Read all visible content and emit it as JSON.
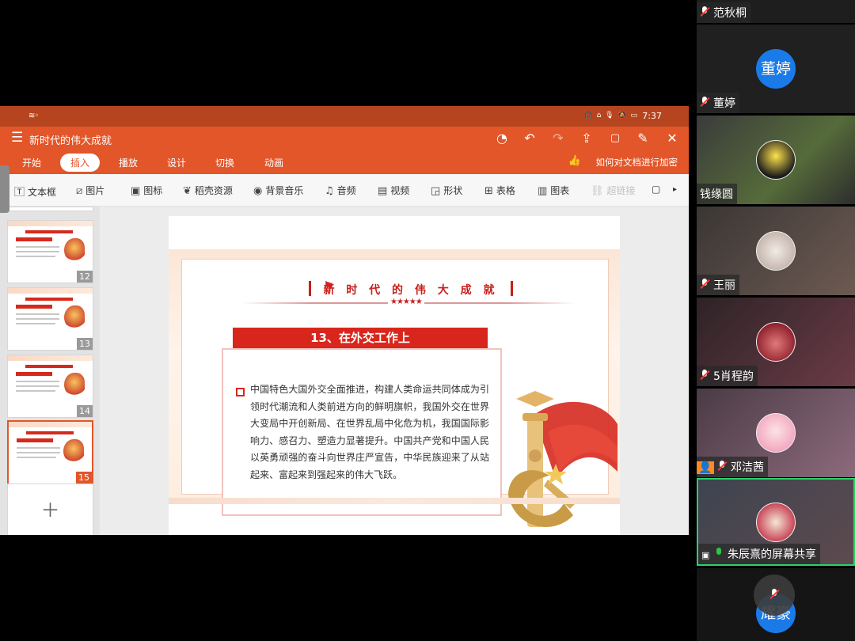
{
  "status_bar": {
    "time": "7:37",
    "battery": "100"
  },
  "document": {
    "title": "新时代的伟大成就"
  },
  "tabs": [
    {
      "label": "开始",
      "active": false
    },
    {
      "label": "插入",
      "active": true
    },
    {
      "label": "播放",
      "active": false
    },
    {
      "label": "设计",
      "active": false
    },
    {
      "label": "切换",
      "active": false
    },
    {
      "label": "动画",
      "active": false
    }
  ],
  "encrypt_link": "如何对文档进行加密",
  "insert_tools": [
    {
      "label": "文本框",
      "icon": "text-box-icon"
    },
    {
      "label": "图片",
      "icon": "image-icon"
    },
    {
      "label": "图标",
      "icon": "icon-library-icon"
    },
    {
      "label": "稻壳资源",
      "icon": "docer-resource-icon"
    },
    {
      "label": "背景音乐",
      "icon": "music-note-icon"
    },
    {
      "label": "音频",
      "icon": "audio-icon"
    },
    {
      "label": "视频",
      "icon": "video-icon"
    },
    {
      "label": "形状",
      "icon": "shape-icon"
    },
    {
      "label": "表格",
      "icon": "table-icon"
    },
    {
      "label": "图表",
      "icon": "chart-icon"
    },
    {
      "label": "超链接",
      "icon": "link-icon",
      "disabled": true
    }
  ],
  "thumbnails": [
    {
      "number": "12",
      "selected": false
    },
    {
      "number": "13",
      "selected": false
    },
    {
      "number": "14",
      "selected": false
    },
    {
      "number": "15",
      "selected": true
    }
  ],
  "slide": {
    "heading": "新 时 代 的 伟 大 成 就",
    "section_title": "13、在外交工作上",
    "body": "中国特色大国外交全面推进，构建人类命运共同体成为引领时代潮流和人类前进方向的鲜明旗帜，我国外交在世界大变局中开创新局、在世界乱局中化危为机，我国国际影响力、感召力、塑造力显著提升。中国共产党和中国人民以英勇顽强的奋斗向世界庄严宣告，中华民族迎来了从站起来、富起来到强起来的伟大飞跃。"
  },
  "participants": [
    {
      "name": "范秋桐",
      "mic": "muted",
      "avatar": "none",
      "bg": "#1e1e1e"
    },
    {
      "name": "董婷",
      "mic": "muted",
      "avatar": "text",
      "avatar_text": "董婷",
      "bg": "#202020"
    },
    {
      "name": "钱缘圆",
      "mic": "none",
      "avatar": "photo",
      "bg": "#3f4a35"
    },
    {
      "name": "王丽",
      "mic": "muted",
      "avatar": "photo",
      "bg": "#5a4a44"
    },
    {
      "name": "5肖程韵",
      "mic": "muted",
      "avatar": "photo",
      "bg": "#52343c"
    },
    {
      "name": "邓洁茜",
      "mic": "muted",
      "avatar": "photo",
      "bg": "#6a5060",
      "host": true
    },
    {
      "name": "朱辰熹的屏幕共享",
      "mic": "active",
      "avatar": "photo",
      "bg": "#3e4450",
      "sharing": true
    },
    {
      "name": "耀豪",
      "mic": "muted",
      "avatar": "text",
      "avatar_text": "耀豪",
      "bg": "#151515"
    }
  ]
}
